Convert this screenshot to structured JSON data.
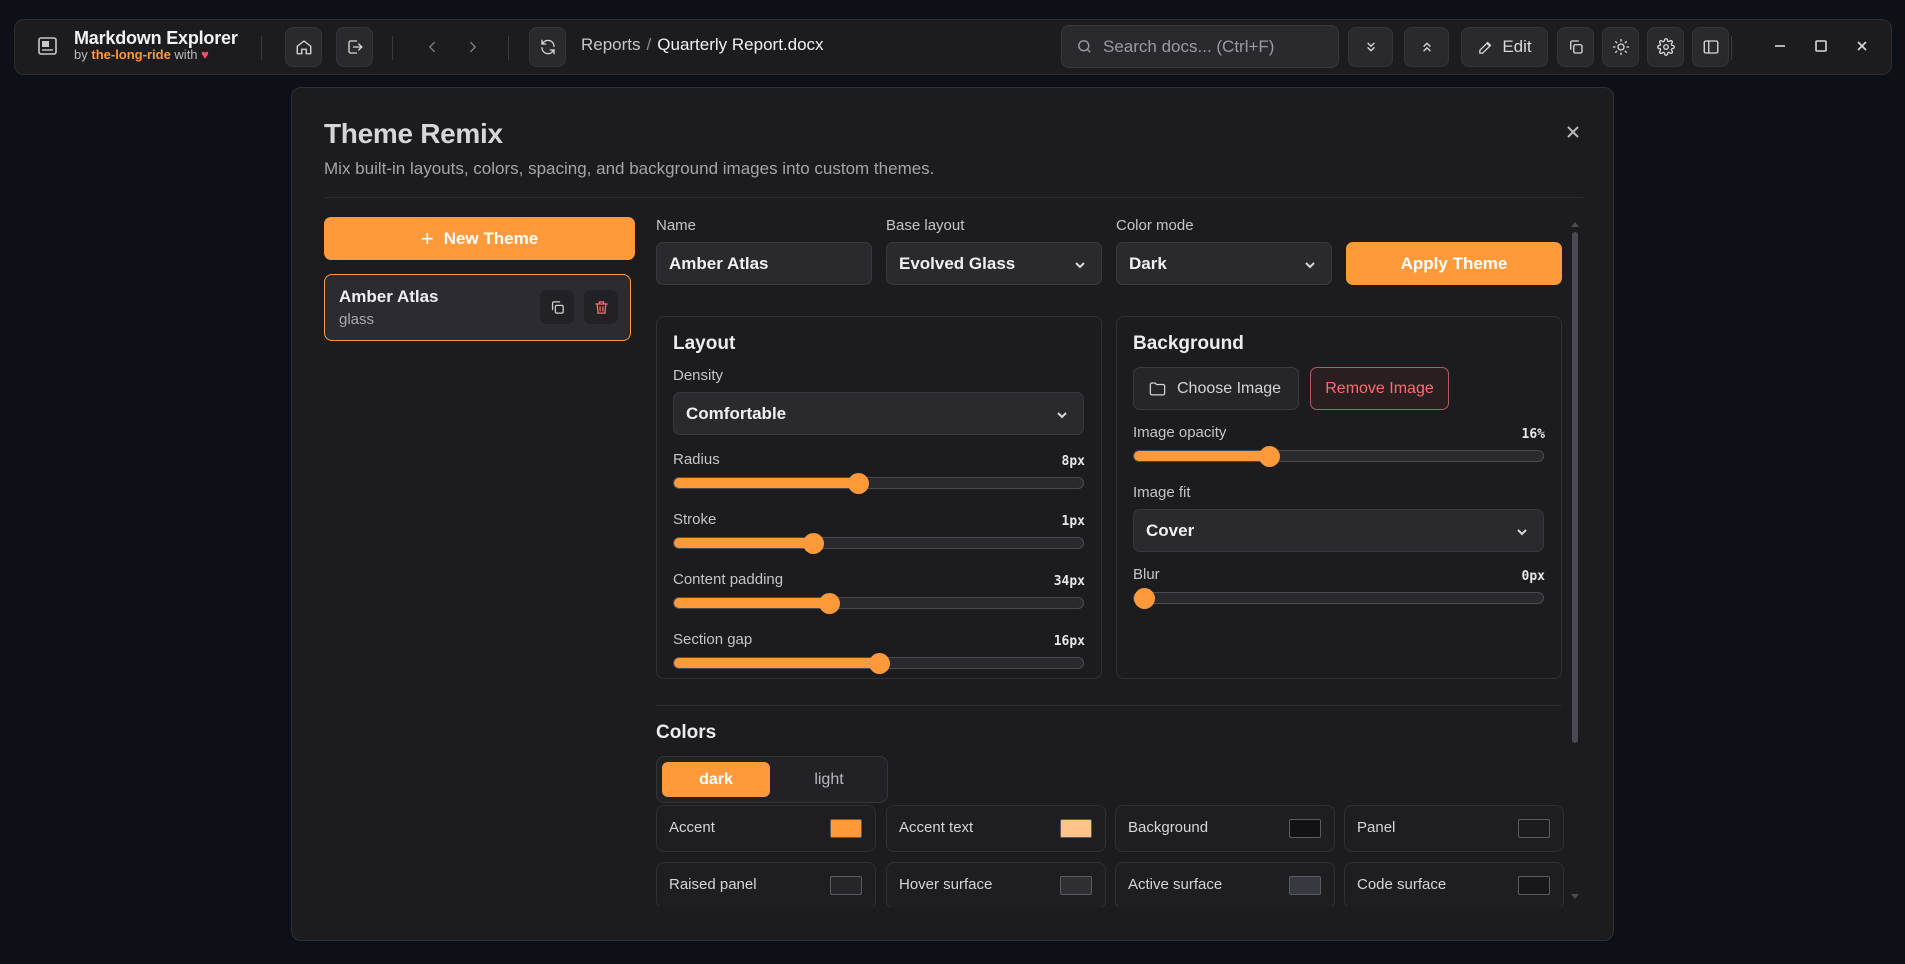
{
  "app": {
    "title": "Markdown Explorer",
    "by_prefix": "by",
    "author": "the-long-ride",
    "with_text": "with",
    "heart": "♥"
  },
  "toolbar": {
    "breadcrumb_root": "Reports",
    "breadcrumb_sep": "/",
    "breadcrumb_current": "Quarterly Report.docx",
    "search_placeholder": "Search docs... (Ctrl+F)",
    "edit_label": "Edit"
  },
  "modal": {
    "title": "Theme Remix",
    "subtitle": "Mix built-in layouts, colors, spacing, and background images into custom themes.",
    "new_theme_label": "New Theme",
    "new_theme_plus": "+",
    "themes": [
      {
        "name": "Amber Atlas",
        "layout": "glass"
      }
    ],
    "fields": {
      "name_label": "Name",
      "name_value": "Amber Atlas",
      "base_layout_label": "Base layout",
      "base_layout_value": "Evolved Glass",
      "color_mode_label": "Color mode",
      "color_mode_value": "Dark"
    },
    "apply_label": "Apply Theme",
    "layout": {
      "title": "Layout",
      "density_label": "Density",
      "density_value": "Comfortable",
      "sliders": [
        {
          "label": "Radius",
          "display": "8px",
          "fraction": 0.45
        },
        {
          "label": "Stroke",
          "display": "1px",
          "fraction": 0.34
        },
        {
          "label": "Content padding",
          "display": "34px",
          "fraction": 0.38
        },
        {
          "label": "Section gap",
          "display": "16px",
          "fraction": 0.5
        }
      ]
    },
    "background": {
      "title": "Background",
      "choose_label": "Choose Image",
      "remove_label": "Remove Image",
      "opacity_label": "Image opacity",
      "opacity_display": "16%",
      "opacity_fraction": 0.33,
      "fit_label": "Image fit",
      "fit_value": "Cover",
      "blur_label": "Blur",
      "blur_display": "0px",
      "blur_fraction": 0.0
    },
    "colors": {
      "title": "Colors",
      "modes": [
        "dark",
        "light"
      ],
      "active_mode": "dark",
      "swatches": [
        {
          "label": "Accent",
          "color": "#ff9a3c"
        },
        {
          "label": "Accent text",
          "color": "#ffc48a"
        },
        {
          "label": "Background",
          "color": "#121214"
        },
        {
          "label": "Panel",
          "color": "#1c1c1f"
        },
        {
          "label": "Raised panel",
          "color": "#26262a"
        },
        {
          "label": "Hover surface",
          "color": "#2e2e33"
        },
        {
          "label": "Active surface",
          "color": "#383840"
        },
        {
          "label": "Code surface",
          "color": "#18181b"
        }
      ]
    }
  }
}
